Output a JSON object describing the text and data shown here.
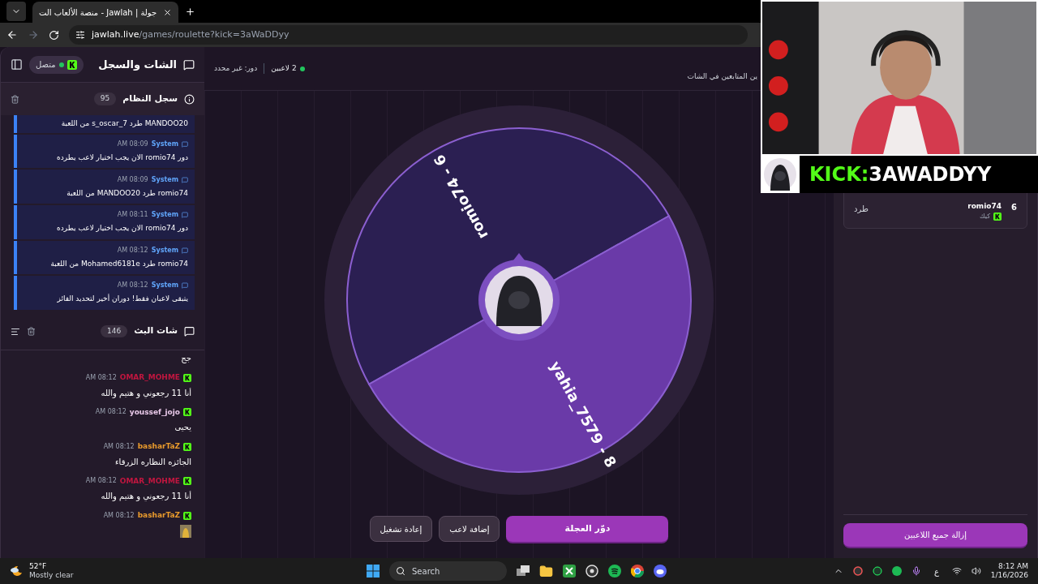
{
  "browser": {
    "tab_title": "جولة | Jawlah - منصة الألعاب الت",
    "url_host": "jawlah.live",
    "url_path": "/games/roulette?kick=3aWaDDyy"
  },
  "sidebar": {
    "title": "الشات والسجل",
    "connection": {
      "label": "متصل",
      "connected": true
    },
    "system_log": {
      "title": "سجل النظام",
      "count": "95",
      "items": [
        {
          "text": "MANDOO20 طرد s_oscar_7 من اللعبة"
        },
        {
          "sender": "System",
          "time": "AM 08:09",
          "text": "دور romio74 الان يجب اختيار لاعب يطرده"
        },
        {
          "sender": "System",
          "time": "AM 08:09",
          "text": "romio74 طرد MANDOO20 من اللعبة"
        },
        {
          "sender": "System",
          "time": "AM 08:11",
          "text": "دور romio74 الان يجب اختيار لاعب يطرده"
        },
        {
          "sender": "System",
          "time": "AM 08:12",
          "text": "romio74 طرد Mohamed6181e من اللعبة"
        },
        {
          "sender": "System",
          "time": "AM 08:12",
          "text": "يتبقى لاعبان فقط! دوران أخير لتحديد الفائز"
        }
      ]
    },
    "stream_chat": {
      "title": "شات البث",
      "count": "146",
      "messages": [
        {
          "kind": "text",
          "text": "جج"
        },
        {
          "kind": "text",
          "user": "OMAR_MOHME",
          "color": "#c0163f",
          "time": "AM 08:12",
          "text": "أنا 11 رجعوني و هتيم والله"
        },
        {
          "kind": "text",
          "user": "youssef_jojo",
          "color": "#e8c8e8",
          "time": "AM 08:12",
          "text": "يحيى"
        },
        {
          "kind": "text",
          "user": "basharTaZ",
          "color": "#e89a2c",
          "time": "AM 08:12",
          "text": "الجائزه النظاره الزرقاء"
        },
        {
          "kind": "text",
          "user": "OMAR_MOHME",
          "color": "#c0163f",
          "time": "AM 08:12",
          "text": "أنا 11 رجعوني و هتيم والله"
        },
        {
          "kind": "emote",
          "user": "basharTaZ",
          "color": "#e89a2c",
          "time": "AM 08:12"
        }
      ]
    }
  },
  "game": {
    "players_count": "2 لاعبين",
    "turn": "دور: غير محدد",
    "hint": "ين المتابعين في الشات",
    "wheel": {
      "segments": [
        {
          "label": "romio74 - 6",
          "color": "#2b1f52"
        },
        {
          "label": "yahia_7579 - 8",
          "color": "#6a3aa8"
        }
      ]
    },
    "buttons": [
      {
        "label": "دوّر العجلة",
        "kind": "primary"
      },
      {
        "label": "إضافة لاعب",
        "kind": "secondary"
      },
      {
        "label": "إعادة تشغيل",
        "kind": "secondary"
      }
    ]
  },
  "players_panel": {
    "players": [
      {
        "number": "6",
        "name": "romio74",
        "platform": "كيك",
        "action": "طرد"
      }
    ],
    "clear_button": "إزالة جميع اللاعبين"
  },
  "stream_overlay": {
    "platform": "KICK:",
    "username": "3AWADDYY"
  },
  "taskbar": {
    "temperature": "52°F",
    "weather": "Mostly clear",
    "search": "Search",
    "language": "ع",
    "time": "8:12 AM",
    "date": "1/16/2026"
  }
}
